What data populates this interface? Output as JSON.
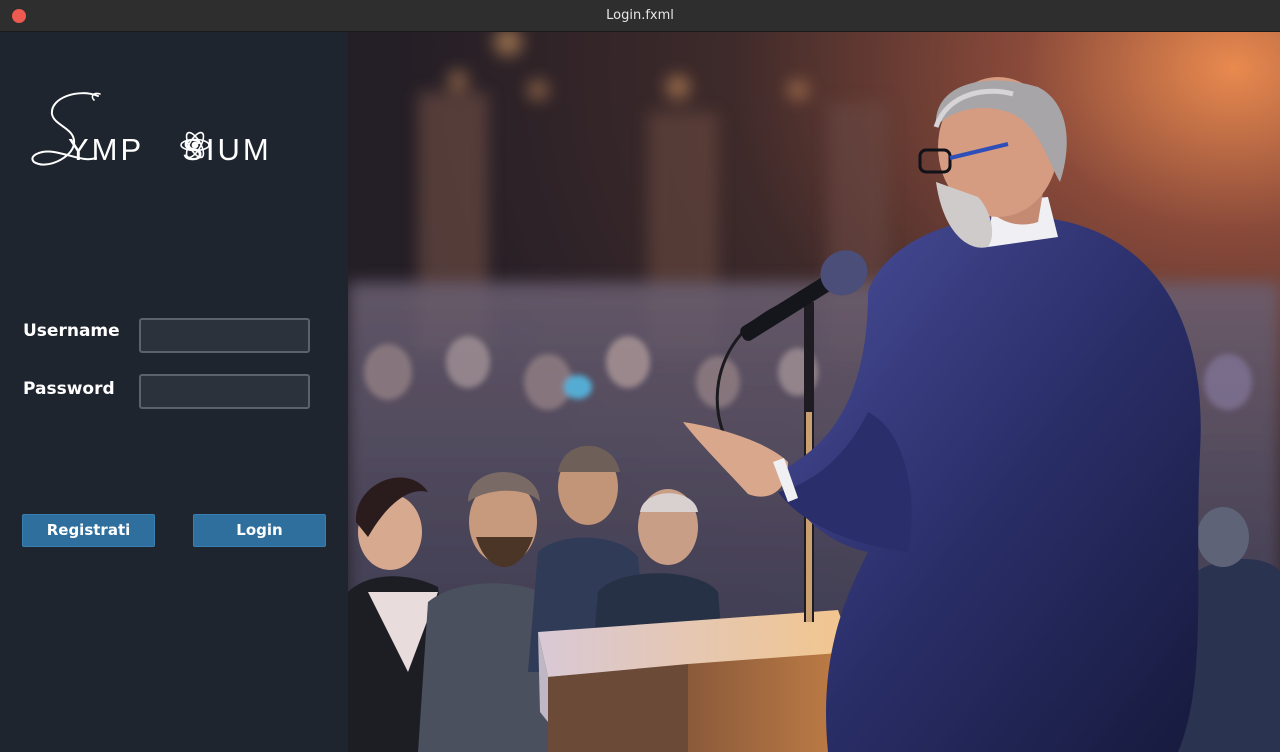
{
  "window": {
    "title": "Login.fxml"
  },
  "logo": {
    "script_letter": "S",
    "text_part1": "YMP",
    "text_part2": "SIUM"
  },
  "form": {
    "username_label": "Username",
    "username_value": "",
    "password_label": "Password",
    "password_value": ""
  },
  "buttons": {
    "register_label": "Registrati",
    "login_label": "Login"
  },
  "colors": {
    "panel_bg": "#1f252e",
    "button_bg": "#2f6f9e",
    "close_button": "#ec5a50"
  }
}
